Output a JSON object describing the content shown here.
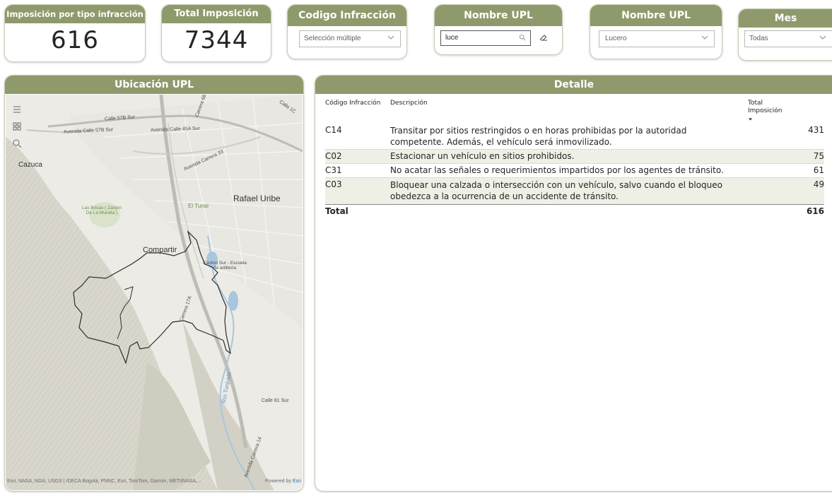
{
  "kpis": {
    "tipo": {
      "label": "Imposición por tipo infracción",
      "value": "616"
    },
    "total": {
      "label": "Total Imposición",
      "value": "7344"
    }
  },
  "slicers": {
    "codigo": {
      "label": "Codigo Infracción",
      "selected": "Selección múltiple"
    },
    "upl_search": {
      "label": "Nombre UPL",
      "search_value": "luce"
    },
    "upl": {
      "label": "Nombre UPL",
      "selected": "Lucero"
    },
    "mes": {
      "label": "Mes",
      "selected": "Todas"
    }
  },
  "map": {
    "title": "Ubicación UPL",
    "labels": {
      "cazuca": "Cazuca",
      "rafael": "Rafael Uribe",
      "compartir": "Compartir",
      "tunal": "El Tunal",
      "brisas": "Las Brisas ( Zanjon De La Muralla )",
      "canton": "Cantón Sur - Escuela de artillería",
      "calle57b": "Calle 57B Sur",
      "av_calle57b": "Avenida Calle 57B Sur",
      "av_calle45a": "Avenida Calle 45A Sur",
      "av_carrera33": "Avenida Carrera 33",
      "carrera68d": "Carrera 68D",
      "carrera17a": "Carrera 17A",
      "rio": "Río Tunjuelo",
      "calle81": "Calle 81 Sur",
      "av_carrera14": "Avenida Carrera 14",
      "av_caracas": "Avenida Carrera",
      "calle1c": "Calle 1C"
    },
    "attribution": "Esri, NASA, NGA, USGS | IDECA Bogotá, PNNC, Esri, TomTom, Garmin, METI/NASA,...",
    "powered": "Powered by",
    "esri": "Esri"
  },
  "detalle": {
    "title": "Detalle",
    "col_codigo": "Código Infracción",
    "col_desc": "Descripción",
    "col_total": "Total Imposición",
    "rows": [
      {
        "codigo": "C14",
        "desc": "Transitar por sitios restringidos o en horas prohibidas por la autoridad competente. Además, el vehículo será inmovilizado.",
        "total": "431"
      },
      {
        "codigo": "C02",
        "desc": "Estacionar un vehículo en sitios prohibidos.",
        "total": "75"
      },
      {
        "codigo": "C31",
        "desc": "No acatar las señales o requerimientos impartidos por los agentes de tránsito.",
        "total": "61"
      },
      {
        "codigo": "C03",
        "desc": "Bloquear una calzada o intersección con un vehículo, salvo cuando el bloqueo obedezca a la ocurrencia de un accidente de tránsito.",
        "total": "49"
      }
    ],
    "total_label": "Total",
    "total_value": "616"
  },
  "colors": {
    "header": "#8f9a6c",
    "row_alt": "#eef0e6"
  },
  "icons": [
    "hamburger-icon",
    "qr-icon",
    "search-icon",
    "eraser-icon",
    "chevron-down-icon",
    "sort-desc-icon"
  ]
}
